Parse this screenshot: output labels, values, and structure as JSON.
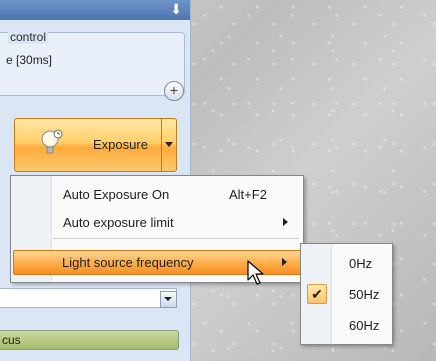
{
  "panel": {
    "title_pin": "⬇",
    "group": {
      "title": "control",
      "value": "e [30ms]"
    },
    "add_symbol": "+"
  },
  "exposure_button": {
    "label": "Exposure"
  },
  "focus": {
    "label": "cus"
  },
  "menu": {
    "items": [
      {
        "label": "Auto Exposure On",
        "shortcut": "Alt+F2"
      },
      {
        "label": "Auto exposure limit"
      },
      {
        "label": "Light source frequency"
      }
    ]
  },
  "submenu": {
    "items": [
      {
        "label": "0Hz",
        "checked": false
      },
      {
        "label": "50Hz",
        "checked": true
      },
      {
        "label": "60Hz",
        "checked": false
      }
    ],
    "check_symbol": "✔"
  },
  "colors": {
    "highlight": "#ffb04d",
    "panel_bg": "#dbe6f4"
  }
}
